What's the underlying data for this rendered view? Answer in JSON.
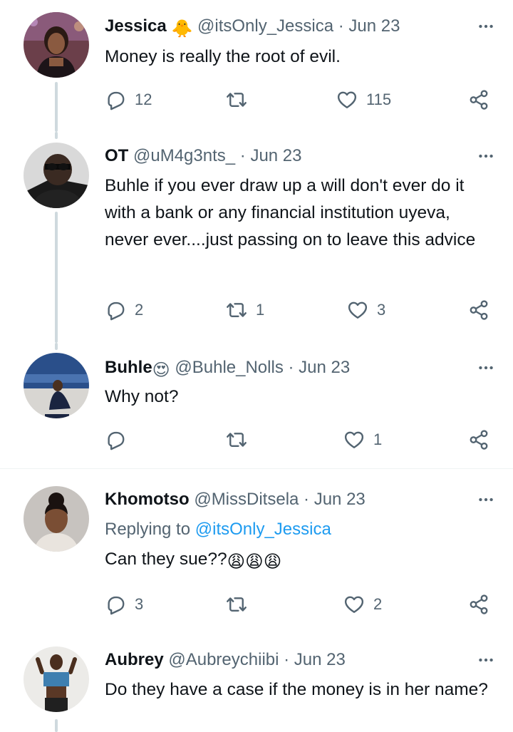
{
  "tweets": [
    {
      "name": "Jessica",
      "emoji": "🐥",
      "handle": "@itsOnly_Jessica",
      "date": "· Jun 23",
      "text": "Money is really the root of evil.",
      "replies": "12",
      "retweets": "",
      "likes": "115"
    },
    {
      "name": "OT",
      "handle": "@uM4g3nts_",
      "date": "· Jun 23",
      "text": "Buhle if you ever draw up a will don't ever do it with a bank or any financial institution uyeva, never ever....just passing on to leave this advice",
      "replies": "2",
      "retweets": "1",
      "likes": "3"
    },
    {
      "name": "Buhle",
      "emoji": "😍",
      "handle": "@Buhle_Nolls",
      "date": "· Jun 23",
      "text": "Why not?",
      "replies": "",
      "retweets": "",
      "likes": "1"
    },
    {
      "name": "Khomotso",
      "handle": "@MissDitsela",
      "date": "· Jun 23",
      "replying_prefix": "Replying to ",
      "replying_to": "@itsOnly_Jessica",
      "text": "Can they sue??",
      "text_emoji": "😩😩😩",
      "replies": "3",
      "retweets": "",
      "likes": "2"
    },
    {
      "name": "Aubrey",
      "handle": "@Aubreychiibi",
      "date": "· Jun 23",
      "text": "Do they have a case if the money is in her name?"
    }
  ],
  "icons": {
    "reply": "reply-icon",
    "retweet": "retweet-icon",
    "like": "heart-icon",
    "share": "share-icon",
    "more": "more-dots-icon"
  },
  "colors": {
    "text": "#0f1419",
    "secondary": "#536471",
    "link": "#1d9bf0",
    "thread_line": "#cfd9de"
  }
}
